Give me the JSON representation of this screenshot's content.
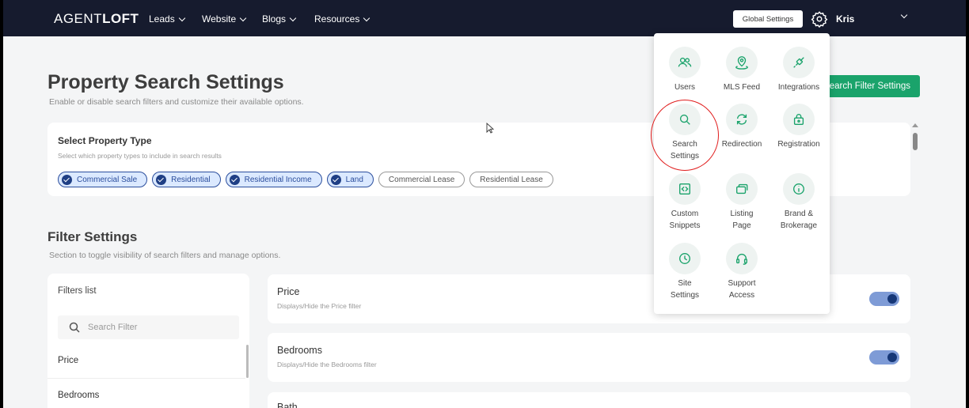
{
  "nav": {
    "logo_part1": "AGENT",
    "logo_part2": "LOFT",
    "items": [
      {
        "label": "Leads"
      },
      {
        "label": "Website"
      },
      {
        "label": "Blogs"
      },
      {
        "label": "Resources"
      }
    ],
    "global_settings_label": "Global Settings",
    "user_name": "Kris"
  },
  "page": {
    "title": "Property Search Settings",
    "subtitle": "Enable or disable search filters and customize their available options.",
    "filter_settings_button": "earch Filter Settings"
  },
  "property_type": {
    "title": "Select Property Type",
    "subtitle": "Select which property types to include in search results",
    "chips": [
      {
        "label": "Commercial Sale",
        "selected": true
      },
      {
        "label": "Residential",
        "selected": true
      },
      {
        "label": "Residential Income",
        "selected": true
      },
      {
        "label": "Land",
        "selected": true
      },
      {
        "label": "Commercial Lease",
        "selected": false
      },
      {
        "label": "Residential Lease",
        "selected": false
      }
    ]
  },
  "filter_settings": {
    "title": "Filter Settings",
    "subtitle": "Section to toggle visibility of search filters and manage options.",
    "list_title": "Filters list",
    "search_placeholder": "Search Filter",
    "list_items": [
      {
        "label": "Price"
      },
      {
        "label": "Bedrooms"
      }
    ],
    "cards": [
      {
        "title": "Price",
        "subtitle": "Displays/Hide the Price filter",
        "enabled": true
      },
      {
        "title": "Bedrooms",
        "subtitle": "Displays/Hide the Bedrooms filter",
        "enabled": true
      },
      {
        "title": "Bath",
        "subtitle": "",
        "enabled": true
      }
    ]
  },
  "global_menu": {
    "items": [
      {
        "label": "Users",
        "icon": "users-icon"
      },
      {
        "label": "MLS Feed",
        "icon": "location-pin-icon"
      },
      {
        "label": "Integrations",
        "icon": "plug-icon"
      },
      {
        "label": "Search",
        "label2": "Settings",
        "icon": "search-icon",
        "highlighted": true
      },
      {
        "label": "Redirection",
        "icon": "refresh-icon"
      },
      {
        "label": "Registration",
        "icon": "lock-icon"
      },
      {
        "label": "Custom",
        "label2": "Snippets",
        "icon": "code-icon"
      },
      {
        "label": "Listing",
        "label2": "Page",
        "icon": "pages-icon"
      },
      {
        "label": "Brand &",
        "label2": "Brokerage",
        "icon": "info-icon"
      },
      {
        "label": "Site",
        "label2": "Settings",
        "icon": "clock-icon"
      },
      {
        "label": "Support",
        "label2": "Access",
        "icon": "headset-icon"
      }
    ]
  },
  "colors": {
    "nav_bg": "#161b2e",
    "accent_green": "#1aa36b",
    "chip_selected": "#1f3f85",
    "highlight_red": "#e01c1c"
  }
}
